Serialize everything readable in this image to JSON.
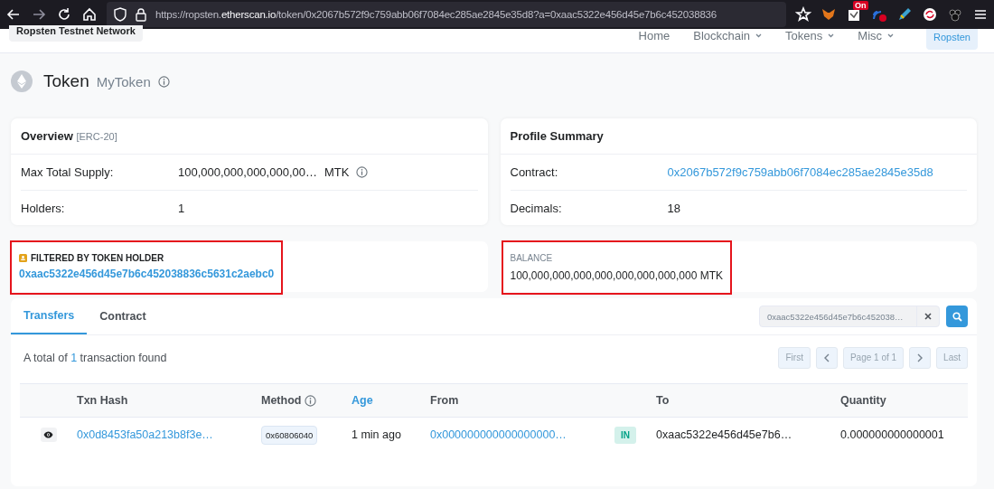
{
  "browser": {
    "url_host": "https://ropsten.",
    "url_domain": "etherscan.io",
    "url_rest": "/token/0x2067b572f9c759abb06f7084ec285ae2845e35d8?a=0xaac5322e456d45e7b6c452038836",
    "extension_badge": "On"
  },
  "site_header": {
    "network": "Ropsten Testnet Network",
    "nav": [
      {
        "label": "Home",
        "dropdown": false
      },
      {
        "label": "Blockchain",
        "dropdown": true
      },
      {
        "label": "Tokens",
        "dropdown": true
      },
      {
        "label": "Misc",
        "dropdown": true
      }
    ],
    "network_button": "Ropsten"
  },
  "page_title": {
    "title": "Token",
    "name": "MyToken"
  },
  "overview": {
    "title": "Overview",
    "tag": "[ERC-20]",
    "rows": [
      {
        "label": "Max Total Supply:",
        "value": "100,000,000,000,000,00…",
        "unit": "MTK",
        "info": true,
        "link": false
      },
      {
        "label": "Holders:",
        "value": "1",
        "unit": "",
        "info": false,
        "link": false
      }
    ]
  },
  "profile": {
    "title": "Profile Summary",
    "rows": [
      {
        "label": "Contract:",
        "value": "0x2067b572f9c759abb06f7084ec285ae2845e35d8",
        "unit": "",
        "info": false,
        "link": true
      },
      {
        "label": "Decimals:",
        "value": "18",
        "unit": "",
        "info": false,
        "link": false
      }
    ]
  },
  "filter": {
    "label": "FILTERED BY TOKEN HOLDER",
    "address": "0xaac5322e456d45e7b6c452038836c5631c2aebc0",
    "highlighted": true
  },
  "balance": {
    "label": "BALANCE",
    "value": "100,000,000,000,000,000,000,000,000 MTK",
    "highlighted": true
  },
  "transfers": {
    "tabs": [
      {
        "label": "Transfers",
        "selected": true
      },
      {
        "label": "Contract",
        "selected": false
      }
    ],
    "search_value": "0xaac5322e456d45e7b6c452038…",
    "summary_pre": "A total of ",
    "summary_count": "1",
    "summary_post": " transaction found",
    "pager": [
      {
        "label": "First",
        "kind": "text"
      },
      {
        "kind": "prev"
      },
      {
        "label": "Page 1 of 1",
        "kind": "text"
      },
      {
        "kind": "next"
      },
      {
        "label": "Last",
        "kind": "text"
      }
    ],
    "columns": [
      {
        "kind": "blank"
      },
      {
        "label": "Txn Hash",
        "kind": "plain"
      },
      {
        "label": "Method",
        "kind": "info"
      },
      {
        "label": "Age",
        "kind": "link"
      },
      {
        "label": "From",
        "kind": "plain"
      },
      {
        "kind": "blank"
      },
      {
        "label": "To",
        "kind": "plain"
      },
      {
        "label": "Quantity",
        "kind": "plain"
      }
    ],
    "rows": [
      {
        "txn_hash": "0x0d8453fa50a213b8f3e…",
        "method": "0x60806040",
        "age": "1 min ago",
        "from": "0x000000000000000000…",
        "direction": "IN",
        "to": "0xaac5322e456d45e7b6…",
        "quantity": "0.000000000000001"
      }
    ]
  }
}
